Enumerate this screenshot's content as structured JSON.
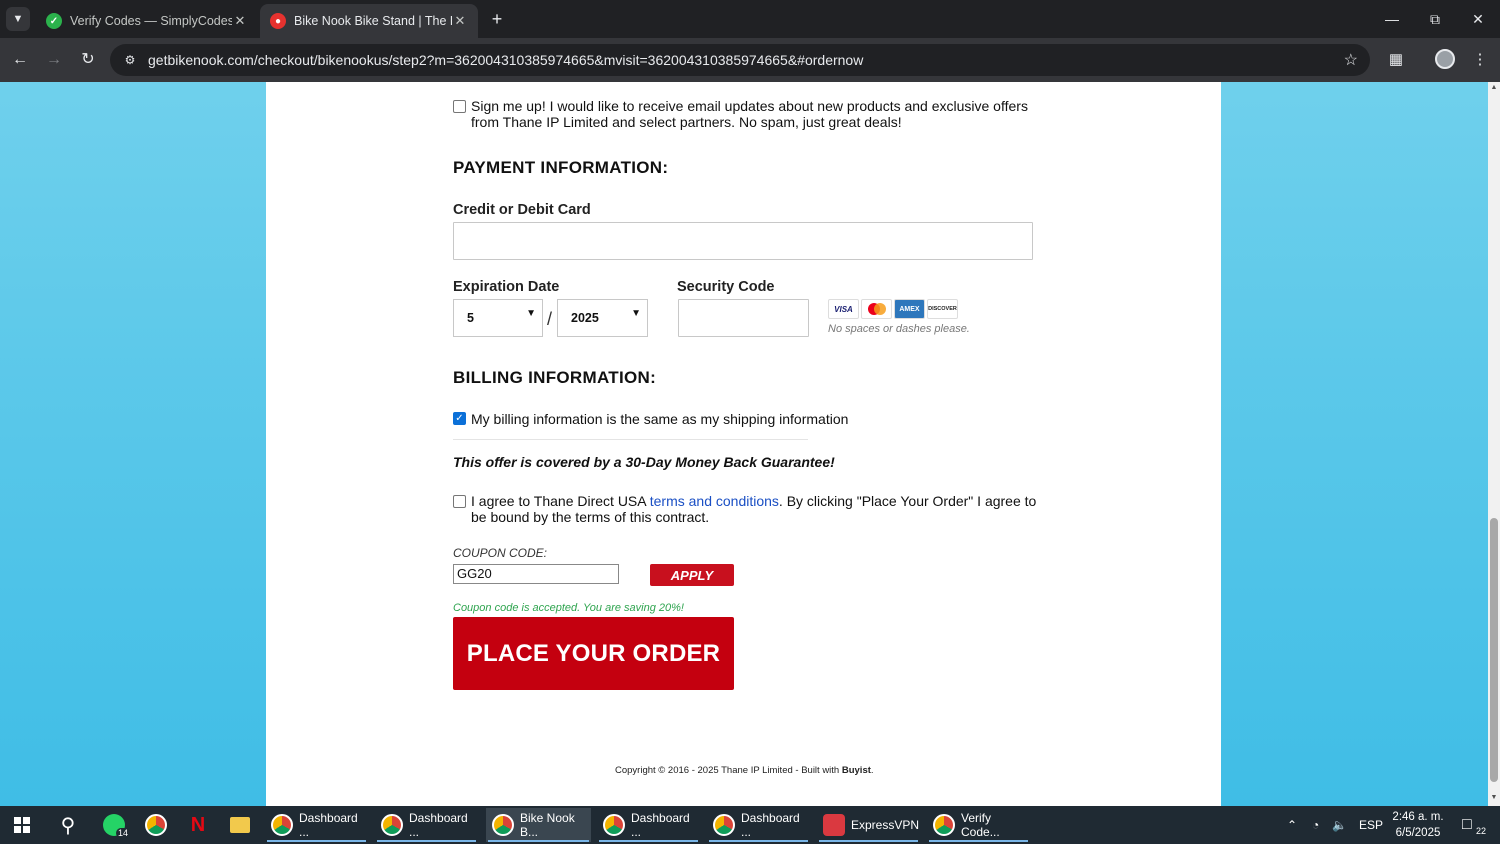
{
  "browser": {
    "tabs": [
      {
        "title": "Verify Codes — SimplyCodes",
        "active": false
      },
      {
        "title": "Bike Nook Bike Stand | The Brill",
        "active": true
      }
    ],
    "url": "getbikenook.com/checkout/bikenookus/step2?m=362004310385974665&mvisit=362004310385974665&#ordernow"
  },
  "form": {
    "signup_text": "Sign me up! I would like to receive email updates about new products and exclusive offers from Thane IP Limited and select partners. No spam, just great deals!",
    "payment_title": "PAYMENT INFORMATION:",
    "card_label": "Credit or Debit Card",
    "card_value": "",
    "expiration_label": "Expiration Date",
    "exp_month": "5",
    "exp_year": "2025",
    "slash": "/",
    "security_label": "Security Code",
    "security_value": "",
    "card_logos": [
      "VISA",
      "MC",
      "AMEX",
      "DISCOVER"
    ],
    "card_hint": "No spaces or dashes please.",
    "billing_title": "BILLING INFORMATION:",
    "billing_same_text": "My billing information is the same as my shipping information",
    "billing_same_checked": true,
    "guarantee": "This offer is covered by a 30-Day Money Back Guarantee!",
    "terms_prefix": "I agree to Thane Direct USA ",
    "terms_link": "terms and conditions",
    "terms_suffix": ". By clicking \"Place Your Order\" I agree to be bound by the terms of this contract.",
    "coupon_label": "COUPON CODE:",
    "coupon_value": "GG20",
    "apply_label": "APPLY",
    "coupon_success": "Coupon code is accepted. You are saving 20%!",
    "order_button": "PLACE YOUR ORDER",
    "copyright_prefix": "Copyright © 2016 - 2025 Thane IP Limited - Built with ",
    "copyright_brand": "Buyist",
    "copyright_suffix": "."
  },
  "taskbar": {
    "apps": [
      {
        "label": "Dashboard ...",
        "active": false
      },
      {
        "label": "Dashboard ...",
        "active": false
      },
      {
        "label": "Bike Nook B...",
        "active": true
      },
      {
        "label": "Dashboard ...",
        "active": false
      },
      {
        "label": "Dashboard ...",
        "active": false
      },
      {
        "label": "ExpressVPN",
        "active": false
      },
      {
        "label": "Verify Code...",
        "active": false
      }
    ],
    "whatsapp_badge": "14",
    "language": "ESP",
    "time": "2:46 a. m.",
    "date": "6/5/2025",
    "notifications": "22"
  },
  "colors": {
    "order_button": "#c4000f",
    "link": "#1a4fc4",
    "success": "#2fa44f",
    "background": "#3fbde6"
  }
}
